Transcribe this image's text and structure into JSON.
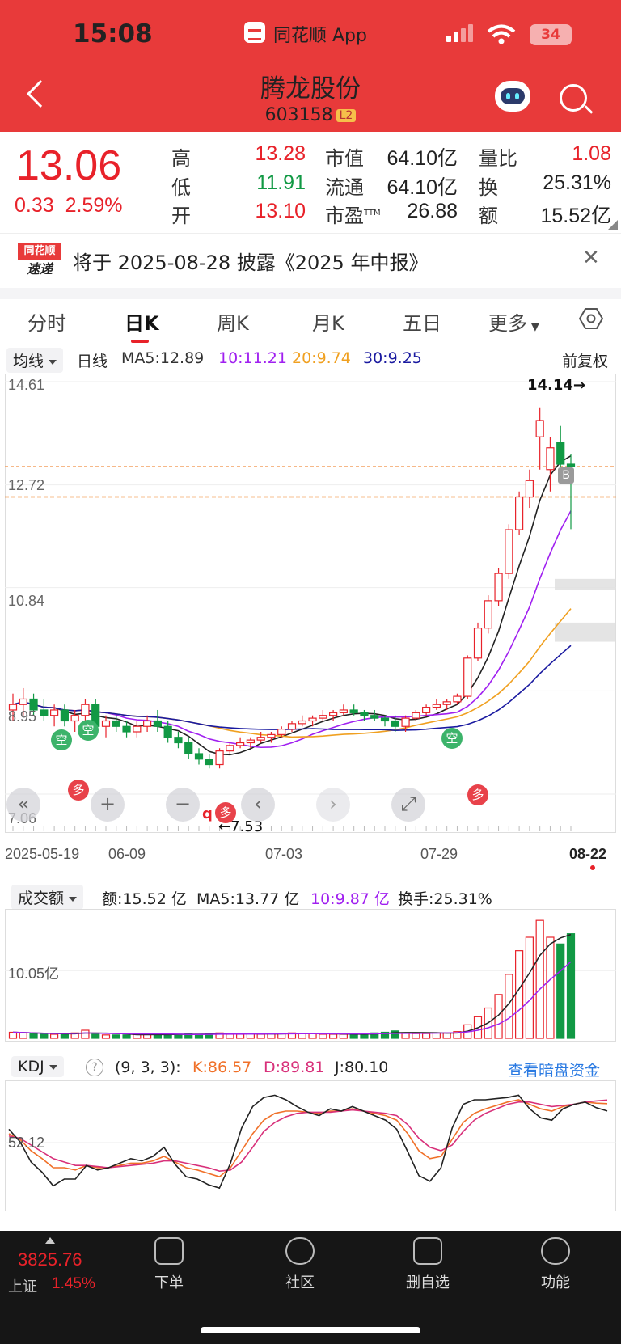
{
  "status_bar": {
    "time": "15:08",
    "app_name": "同花顺 App",
    "battery": "34"
  },
  "header": {
    "stock_name": "腾龙股份",
    "stock_code": "603158",
    "level_badge": "L2"
  },
  "quote": {
    "price": "13.06",
    "change": "0.33",
    "change_pct": "2.59%",
    "fields": {
      "high_label": "高",
      "high": "13.28",
      "low_label": "低",
      "low": "11.91",
      "open_label": "开",
      "open": "13.10",
      "mktcap_label": "市值",
      "mktcap": "64.10亿",
      "float_label": "流通",
      "float": "64.10亿",
      "pe_label": "市盈",
      "pe_sup": "TTM",
      "pe": "26.88",
      "volratio_label": "量比",
      "volratio": "1.08",
      "turnover_label": "换",
      "turnover": "25.31%",
      "amount_label": "额",
      "amount": "15.52亿"
    }
  },
  "notice": {
    "logo_top": "同花顺",
    "logo_bottom": "速递",
    "text": "将于 2025-08-28 披露《2025 年中报》"
  },
  "tabs": [
    "分时",
    "日K",
    "周K",
    "月K",
    "五日",
    "更多"
  ],
  "ma_legend": {
    "selector": "均线",
    "period": "日线",
    "ma5": "MA5:12.89",
    "ma10": "10:11.21",
    "ma20": "20:9.74",
    "ma30": "30:9.25",
    "adjust": "前复权"
  },
  "price_axis": [
    "14.61",
    "12.72",
    "10.84",
    "8.95",
    "7.06"
  ],
  "annotations": {
    "high_mark": "14.14→",
    "low_mark": "←7.53",
    "buy_badge": "B",
    "empty_1": "空",
    "empty_2": "空",
    "empty_3": "空",
    "more_1": "多",
    "more_2": "多",
    "more_3": "多",
    "q_mark": "q"
  },
  "date_axis": [
    "2025-05-19",
    "06-09",
    "07-03",
    "07-29",
    "08-22"
  ],
  "vol_legend": {
    "selector": "成交额",
    "amount": "额:15.52 亿",
    "ma5": "MA5:13.77 亿",
    "ma10": "10:9.87 亿",
    "turnover": "换手:25.31%"
  },
  "vol_axis": "10.05亿",
  "kdj_legend": {
    "selector": "KDJ",
    "help": "?",
    "params": "(9, 3, 3):",
    "k": "K:86.57",
    "d": "D:89.81",
    "j": "J:80.10",
    "link": "查看暗盘资金"
  },
  "kdj_axis": "52.12",
  "bottom_bar": {
    "index_value": "3825.76",
    "index_name": "上证",
    "index_pct": "1.45%",
    "nav": [
      "下单",
      "社区",
      "删自选",
      "功能"
    ]
  },
  "colors": {
    "up": "#e8222a",
    "down": "#119944",
    "ma5": "#222222",
    "ma10": "#a020f0",
    "ma20": "#f0a020",
    "ma30": "#1a1aa0"
  },
  "chart_data": [
    {
      "type": "candlestick",
      "title": "",
      "ylim": [
        7.06,
        14.61
      ],
      "y_ticks": [
        14.61,
        12.72,
        10.84,
        8.95,
        7.06
      ],
      "x_ticks": [
        "2025-05-19",
        "06-09",
        "07-03",
        "07-29",
        "08-22"
      ],
      "candles": [
        [
          8.6,
          8.9,
          8.4,
          8.7
        ],
        [
          8.7,
          9.0,
          8.5,
          8.8
        ],
        [
          8.8,
          8.9,
          8.5,
          8.6
        ],
        [
          8.6,
          8.8,
          8.4,
          8.5
        ],
        [
          8.5,
          8.7,
          8.3,
          8.6
        ],
        [
          8.6,
          8.7,
          8.3,
          8.4
        ],
        [
          8.4,
          8.6,
          8.2,
          8.5
        ],
        [
          8.5,
          8.8,
          8.4,
          8.7
        ],
        [
          8.7,
          8.8,
          8.2,
          8.3
        ],
        [
          8.3,
          8.5,
          8.1,
          8.4
        ],
        [
          8.4,
          8.5,
          8.2,
          8.3
        ],
        [
          8.3,
          8.4,
          8.1,
          8.2
        ],
        [
          8.2,
          8.4,
          8.1,
          8.3
        ],
        [
          8.3,
          8.5,
          8.2,
          8.4
        ],
        [
          8.4,
          8.6,
          8.2,
          8.3
        ],
        [
          8.3,
          8.4,
          8.0,
          8.1
        ],
        [
          8.1,
          8.2,
          7.9,
          8.0
        ],
        [
          8.0,
          8.1,
          7.7,
          7.8
        ],
        [
          7.8,
          7.9,
          7.6,
          7.7
        ],
        [
          7.7,
          7.8,
          7.53,
          7.6
        ],
        [
          7.6,
          7.9,
          7.53,
          7.85
        ],
        [
          7.85,
          8.0,
          7.8,
          7.95
        ],
        [
          7.95,
          8.1,
          7.9,
          8.0
        ],
        [
          8.0,
          8.1,
          7.9,
          8.05
        ],
        [
          8.05,
          8.2,
          8.0,
          8.1
        ],
        [
          8.1,
          8.2,
          8.0,
          8.15
        ],
        [
          8.15,
          8.3,
          8.1,
          8.25
        ],
        [
          8.25,
          8.4,
          8.2,
          8.35
        ],
        [
          8.35,
          8.5,
          8.3,
          8.4
        ],
        [
          8.4,
          8.5,
          8.3,
          8.45
        ],
        [
          8.45,
          8.6,
          8.4,
          8.5
        ],
        [
          8.5,
          8.6,
          8.4,
          8.55
        ],
        [
          8.55,
          8.7,
          8.5,
          8.6
        ],
        [
          8.6,
          8.7,
          8.5,
          8.55
        ],
        [
          8.55,
          8.6,
          8.4,
          8.5
        ],
        [
          8.5,
          8.6,
          8.4,
          8.45
        ],
        [
          8.45,
          8.5,
          8.3,
          8.4
        ],
        [
          8.4,
          8.5,
          8.2,
          8.3
        ],
        [
          8.3,
          8.5,
          8.2,
          8.45
        ],
        [
          8.45,
          8.6,
          8.4,
          8.55
        ],
        [
          8.55,
          8.7,
          8.5,
          8.65
        ],
        [
          8.65,
          8.8,
          8.6,
          8.7
        ],
        [
          8.7,
          8.8,
          8.6,
          8.75
        ],
        [
          8.75,
          8.9,
          8.7,
          8.85
        ],
        [
          8.85,
          9.6,
          8.8,
          9.55
        ],
        [
          9.55,
          10.2,
          9.5,
          10.1
        ],
        [
          10.1,
          10.7,
          10.0,
          10.6
        ],
        [
          10.6,
          11.2,
          10.5,
          11.1
        ],
        [
          11.1,
          12.0,
          11.0,
          11.9
        ],
        [
          11.9,
          12.6,
          11.8,
          12.5
        ],
        [
          12.5,
          13.0,
          12.3,
          12.8
        ],
        [
          13.6,
          14.14,
          13.0,
          13.9
        ],
        [
          13.0,
          13.6,
          12.6,
          13.4
        ],
        [
          13.5,
          13.8,
          12.9,
          13.1
        ],
        [
          13.1,
          13.28,
          11.91,
          13.06
        ]
      ]
    },
    {
      "type": "bar",
      "title": "成交额",
      "ylabel": "亿",
      "reference": 10.05,
      "values": [
        0.9,
        0.8,
        0.7,
        0.6,
        0.6,
        0.7,
        0.8,
        1.2,
        0.6,
        0.5,
        0.5,
        0.5,
        0.6,
        0.6,
        0.6,
        0.5,
        0.6,
        0.7,
        0.6,
        0.7,
        0.8,
        0.6,
        0.6,
        0.7,
        0.6,
        0.7,
        0.7,
        0.8,
        0.7,
        0.7,
        0.6,
        0.6,
        0.6,
        0.6,
        0.7,
        0.8,
        0.9,
        1.1,
        0.8,
        0.7,
        0.7,
        0.8,
        0.8,
        1.0,
        2.0,
        3.2,
        4.5,
        6.5,
        9.5,
        13.0,
        15.0,
        17.5,
        15.0,
        14.0,
        15.52
      ]
    },
    {
      "type": "line",
      "title": "KDJ",
      "reference": 52.12,
      "series": [
        {
          "name": "K",
          "values": [
            60,
            55,
            45,
            38,
            30,
            30,
            28,
            32,
            30,
            30,
            32,
            34,
            34,
            36,
            40,
            35,
            30,
            28,
            25,
            22,
            30,
            45,
            60,
            72,
            78,
            80,
            80,
            79,
            78,
            80,
            80,
            82,
            80,
            78,
            76,
            72,
            60,
            45,
            38,
            40,
            55,
            70,
            78,
            82,
            85,
            88,
            90,
            86,
            82,
            80,
            84,
            86,
            88,
            87,
            86.57
          ]
        },
        {
          "name": "D",
          "values": [
            58,
            56,
            50,
            44,
            38,
            35,
            32,
            32,
            31,
            30,
            31,
            32,
            33,
            34,
            36,
            36,
            34,
            32,
            30,
            27,
            28,
            35,
            48,
            62,
            70,
            75,
            78,
            79,
            79,
            79,
            80,
            81,
            80,
            79,
            78,
            76,
            68,
            56,
            48,
            45,
            50,
            62,
            72,
            78,
            82,
            86,
            88,
            88,
            86,
            84,
            85,
            86,
            88,
            89,
            89.81
          ]
        },
        {
          "name": "J",
          "values": [
            64,
            53,
            35,
            26,
            14,
            20,
            20,
            32,
            28,
            30,
            34,
            38,
            36,
            40,
            48,
            33,
            22,
            20,
            15,
            12,
            34,
            65,
            84,
            92,
            94,
            90,
            84,
            79,
            76,
            82,
            80,
            84,
            80,
            76,
            72,
            64,
            44,
            23,
            18,
            30,
            65,
            86,
            90,
            90,
            91,
            92,
            94,
            82,
            74,
            72,
            82,
            86,
            88,
            83,
            80.1
          ]
        }
      ]
    }
  ]
}
